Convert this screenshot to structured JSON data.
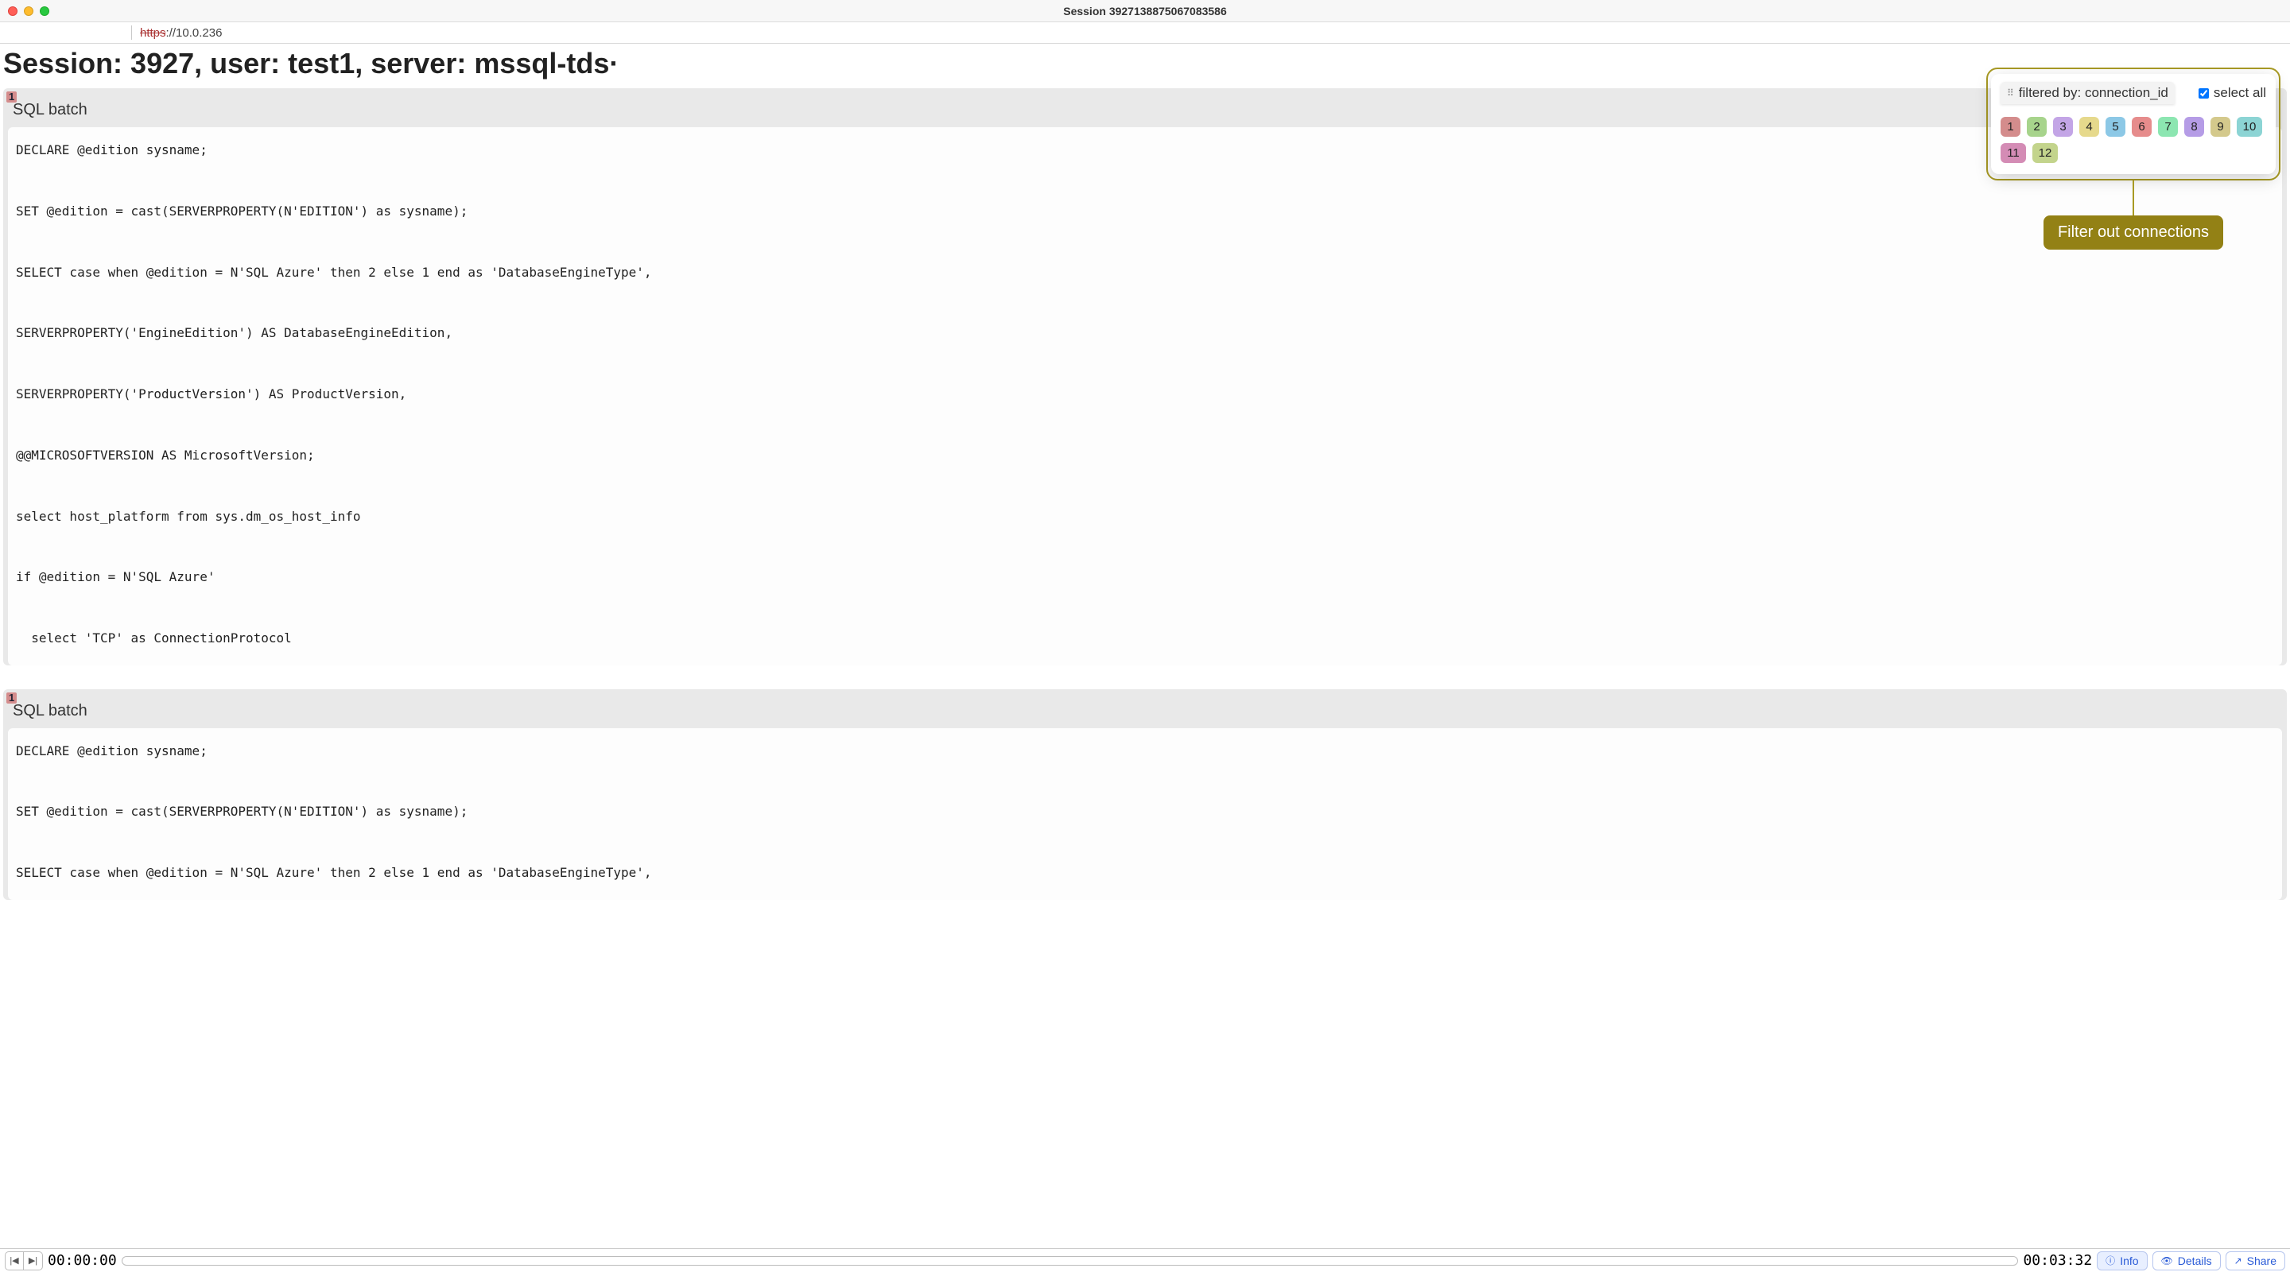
{
  "window": {
    "title": "Session 3927138875067083586"
  },
  "url": {
    "scheme": "https",
    "rest": "://10.0.236"
  },
  "page_title": "Session: 3927, user: test1, server: mssql-tds·",
  "blocks": [
    {
      "badge": "1",
      "heading": "SQL batch",
      "code": "DECLARE @edition sysname;\n\nSET @edition = cast(SERVERPROPERTY(N'EDITION') as sysname);\n\nSELECT case when @edition = N'SQL Azure' then 2 else 1 end as 'DatabaseEngineType',\n\nSERVERPROPERTY('EngineEdition') AS DatabaseEngineEdition,\n\nSERVERPROPERTY('ProductVersion') AS ProductVersion,\n\n@@MICROSOFTVERSION AS MicrosoftVersion;\n\nselect host_platform from sys.dm_os_host_info\n\nif @edition = N'SQL Azure'\n\n  select 'TCP' as ConnectionProtocol"
    },
    {
      "badge": "1",
      "heading": "SQL batch",
      "code": "DECLARE @edition sysname;\n\nSET @edition = cast(SERVERPROPERTY(N'EDITION') as sysname);\n\nSELECT case when @edition = N'SQL Azure' then 2 else 1 end as 'DatabaseEngineType',"
    }
  ],
  "filter": {
    "label": "filtered by: connection_id",
    "select_all": "select all",
    "select_all_checked": true,
    "chips": [
      {
        "n": "1",
        "bg": "#d48c8c"
      },
      {
        "n": "2",
        "bg": "#a7d48c"
      },
      {
        "n": "3",
        "bg": "#c3a5e6"
      },
      {
        "n": "4",
        "bg": "#e6d98c"
      },
      {
        "n": "5",
        "bg": "#8cc8e6"
      },
      {
        "n": "6",
        "bg": "#e68c8c"
      },
      {
        "n": "7",
        "bg": "#8ce6b1"
      },
      {
        "n": "8",
        "bg": "#b59ce6"
      },
      {
        "n": "9",
        "bg": "#d4c98c"
      },
      {
        "n": "10",
        "bg": "#8cd4d4"
      },
      {
        "n": "11",
        "bg": "#d48cb5"
      },
      {
        "n": "12",
        "bg": "#c3d48c"
      }
    ],
    "callout": "Filter out connections"
  },
  "player": {
    "start": "00:00:00",
    "end": "00:03:32",
    "info": "Info",
    "details": "Details",
    "share": "Share"
  }
}
